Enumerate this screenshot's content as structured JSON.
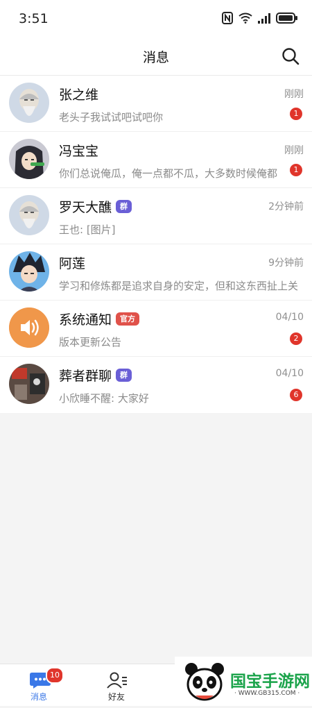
{
  "status_bar": {
    "time": "3:51"
  },
  "header": {
    "title": "消息"
  },
  "conversations": [
    {
      "name": "张之维",
      "preview": "老头子我试试吧试吧你",
      "time": "刚刚",
      "badge": "1",
      "tag": ""
    },
    {
      "name": "冯宝宝",
      "preview": "你们总说俺瓜，俺一点都不瓜，大多数时候俺都",
      "time": "刚刚",
      "badge": "1",
      "tag": ""
    },
    {
      "name": "罗天大醮",
      "preview": "王也: [图片]",
      "time": "2分钟前",
      "badge": "",
      "tag": "群",
      "tag_color": "#6a5fd6"
    },
    {
      "name": "阿莲",
      "preview": "学习和修炼都是追求自身的安定，但和这东西扯上关",
      "time": "9分钟前",
      "badge": "",
      "tag": ""
    },
    {
      "name": "系统通知",
      "preview": "版本更新公告",
      "time": "04/10",
      "badge": "2",
      "tag": "官方",
      "tag_color": "#e0524a"
    },
    {
      "name": "葬者群聊",
      "preview": "小欣睡不醒: 大家好",
      "time": "04/10",
      "badge": "6",
      "tag": "群",
      "tag_color": "#6a5fd6"
    }
  ],
  "tabbar": {
    "messages": {
      "label": "消息",
      "badge": "10"
    },
    "friends": {
      "label": "好友"
    }
  },
  "watermark": {
    "brand": "国宝手游网",
    "url": "· WWW.GB315.COM ·"
  },
  "colors": {
    "accent": "#3b78e7",
    "badge_red": "#e0352b",
    "system_orange": "#f0974a"
  }
}
